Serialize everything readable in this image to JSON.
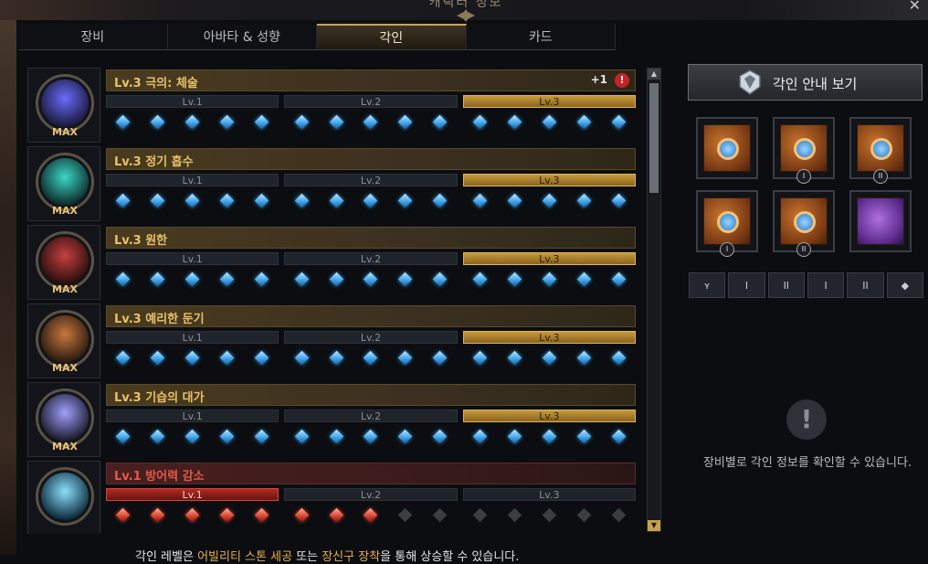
{
  "window": {
    "title": "캐릭터 정보",
    "close_icon": "close-icon"
  },
  "tabs": [
    {
      "label": "장비",
      "active": false
    },
    {
      "label": "아바타 & 성향",
      "active": false
    },
    {
      "label": "각인",
      "active": true
    },
    {
      "label": "카드",
      "active": false
    }
  ],
  "engravings": [
    {
      "name": "Lv.3 극의: 체술",
      "max": "MAX",
      "plus": "+1",
      "alert": "!",
      "levels": [
        "Lv.1",
        "Lv.2",
        "Lv.3"
      ],
      "active_level": 3,
      "gems_filled": 15,
      "color": "gold"
    },
    {
      "name": "Lv.3 정기 흡수",
      "max": "MAX",
      "levels": [
        "Lv.1",
        "Lv.2",
        "Lv.3"
      ],
      "active_level": 3,
      "gems_filled": 15,
      "color": "gold"
    },
    {
      "name": "Lv.3 원한",
      "max": "MAX",
      "levels": [
        "Lv.1",
        "Lv.2",
        "Lv.3"
      ],
      "active_level": 3,
      "gems_filled": 15,
      "color": "gold"
    },
    {
      "name": "Lv.3 예리한 둔기",
      "max": "MAX",
      "levels": [
        "Lv.1",
        "Lv.2",
        "Lv.3"
      ],
      "active_level": 3,
      "gems_filled": 15,
      "color": "gold"
    },
    {
      "name": "Lv.3 기습의 대가",
      "max": "MAX",
      "levels": [
        "Lv.1",
        "Lv.2",
        "Lv.3"
      ],
      "active_level": 3,
      "gems_filled": 15,
      "color": "gold"
    },
    {
      "name": "Lv.1 방어력 감소",
      "max": "",
      "levels": [
        "Lv.1",
        "Lv.2",
        "Lv.3"
      ],
      "active_level": 1,
      "gems_filled": 8,
      "color": "red"
    }
  ],
  "guide_button": {
    "label": "각인 안내 보기"
  },
  "equipment_slots": [
    {
      "name": "necklace-slot",
      "num": ""
    },
    {
      "name": "earring-1-slot",
      "num": "I"
    },
    {
      "name": "earring-2-slot",
      "num": "II"
    },
    {
      "name": "ring-1-slot",
      "num": "I"
    },
    {
      "name": "ring-2-slot",
      "num": "II"
    },
    {
      "name": "stone-slot",
      "num": ""
    }
  ],
  "filters": [
    {
      "icon": "necklace-icon",
      "label": "ʏ"
    },
    {
      "icon": "earring-1-icon",
      "label": "I"
    },
    {
      "icon": "earring-2-icon",
      "label": "II"
    },
    {
      "icon": "ring-1-icon",
      "label": "I"
    },
    {
      "icon": "ring-2-icon",
      "label": "II"
    },
    {
      "icon": "stone-icon",
      "label": "◆"
    }
  ],
  "info": {
    "icon": "!",
    "text": "장비별로 각인 정보를 확인할 수 있습니다."
  },
  "bottom_note": {
    "prefix": "각인 레벨은 ",
    "hl1": "어빌리티 스톤 세공",
    "mid": " 또는 ",
    "hl2": "장신구 장착",
    "suffix": "을 통해 상승할 수 있습니다."
  }
}
